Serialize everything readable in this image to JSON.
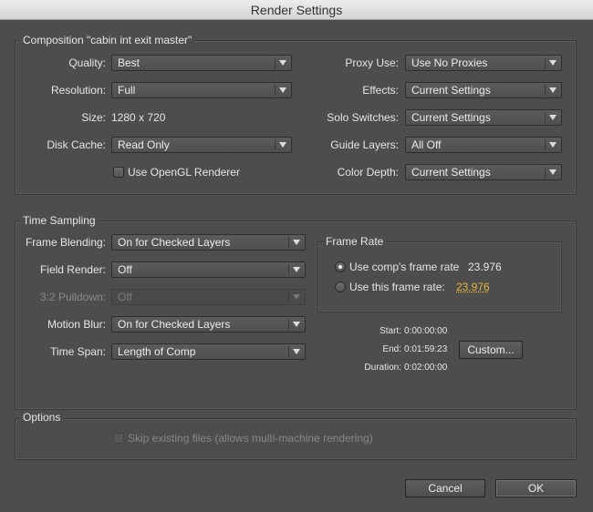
{
  "window": {
    "title": "Render Settings"
  },
  "composition": {
    "title": "Composition \"cabin int exit master\"",
    "quality": {
      "label": "Quality:",
      "value": "Best"
    },
    "resolution": {
      "label": "Resolution:",
      "value": "Full"
    },
    "size": {
      "label": "Size:",
      "value": "1280 x 720"
    },
    "disk_cache": {
      "label": "Disk Cache:",
      "value": "Read Only"
    },
    "opengl": {
      "label": "Use OpenGL Renderer",
      "checked": false
    },
    "proxy_use": {
      "label": "Proxy Use:",
      "value": "Use No Proxies"
    },
    "effects": {
      "label": "Effects:",
      "value": "Current Settings"
    },
    "solo_switches": {
      "label": "Solo Switches:",
      "value": "Current Settings"
    },
    "guide_layers": {
      "label": "Guide Layers:",
      "value": "All Off"
    },
    "color_depth": {
      "label": "Color Depth:",
      "value": "Current Settings"
    }
  },
  "time_sampling": {
    "title": "Time Sampling",
    "frame_blending": {
      "label": "Frame Blending:",
      "value": "On for Checked Layers"
    },
    "field_render": {
      "label": "Field Render:",
      "value": "Off"
    },
    "pulldown": {
      "label": "3:2 Pulldown:",
      "value": "Off"
    },
    "motion_blur": {
      "label": "Motion Blur:",
      "value": "On for Checked Layers"
    },
    "time_span": {
      "label": "Time Span:",
      "value": "Length of Comp"
    },
    "frame_rate": {
      "title": "Frame Rate",
      "use_comp": {
        "label": "Use comp's frame rate",
        "value": "23.976",
        "selected": true
      },
      "use_this": {
        "label": "Use this frame rate:",
        "value": "23.976",
        "selected": false
      }
    },
    "start": {
      "label": "Start:",
      "value": "0:00:00:00"
    },
    "end": {
      "label": "End:",
      "value": "0:01:59:23"
    },
    "duration": {
      "label": "Duration:",
      "value": "0:02:00:00"
    },
    "custom_button": "Custom..."
  },
  "options": {
    "title": "Options",
    "skip_existing": {
      "label": "Skip existing files (allows multi-machine rendering)",
      "checked": false,
      "enabled": false
    }
  },
  "buttons": {
    "cancel": "Cancel",
    "ok": "OK"
  },
  "colors": {
    "background": "#4d4d4d",
    "link": "#e8b53a",
    "titlebar": "#dcdcdc"
  }
}
